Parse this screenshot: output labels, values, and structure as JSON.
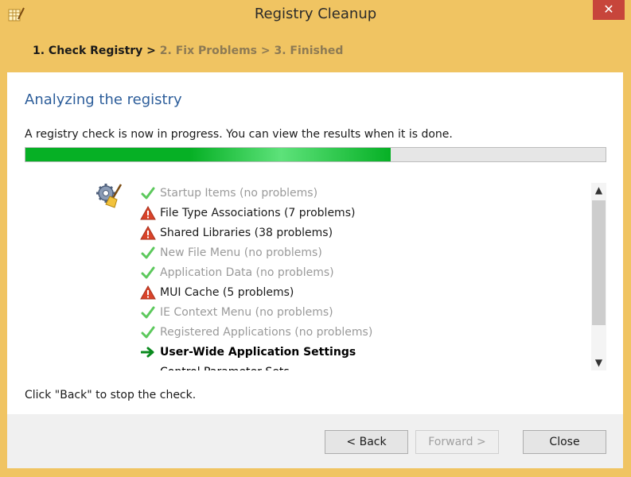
{
  "window": {
    "title": "Registry Cleanup",
    "close_glyph": "✕"
  },
  "steps": {
    "step1": "1. Check Registry >",
    "step2": "2. Fix Problems >",
    "step3": "3. Finished"
  },
  "main": {
    "heading": "Analyzing the registry",
    "description": "A registry check is now in progress. You can view the results when it is done.",
    "progress_fraction": 0.63,
    "stop_message": "Click \"Back\" to stop the check."
  },
  "results": [
    {
      "status": "ok",
      "icon": "check-icon",
      "label": "Startup Items (no problems)"
    },
    {
      "status": "warn",
      "icon": "warning-icon",
      "label": "File Type Associations (7 problems)"
    },
    {
      "status": "warn",
      "icon": "warning-icon",
      "label": "Shared Libraries (38 problems)"
    },
    {
      "status": "ok",
      "icon": "check-icon",
      "label": "New File Menu (no problems)"
    },
    {
      "status": "ok",
      "icon": "check-icon",
      "label": "Application Data (no problems)"
    },
    {
      "status": "warn",
      "icon": "warning-icon",
      "label": "MUI Cache (5 problems)"
    },
    {
      "status": "ok",
      "icon": "check-icon",
      "label": "IE Context Menu (no problems)"
    },
    {
      "status": "ok",
      "icon": "check-icon",
      "label": "Registered Applications (no problems)"
    },
    {
      "status": "current",
      "icon": "arrow-right-icon",
      "label": "User-Wide Application Settings"
    },
    {
      "status": "pending",
      "icon": "",
      "label": "Control Parameter Sets"
    }
  ],
  "buttons": {
    "back": "< Back",
    "forward": "Forward >",
    "close": "Close"
  },
  "colors": {
    "accent_bg": "#f0c462",
    "heading": "#2c5d9a",
    "progress": "#06b025",
    "warning": "#d9432a",
    "check": "#5cc85c"
  }
}
